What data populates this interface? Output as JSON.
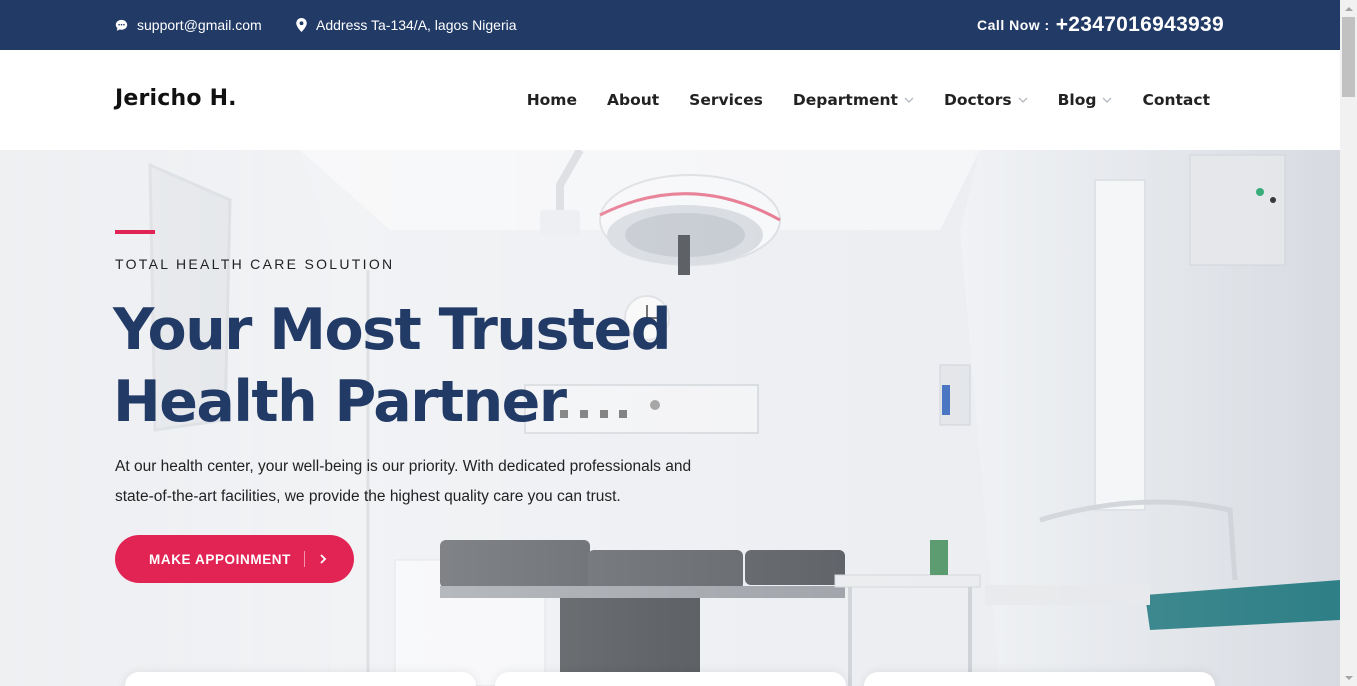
{
  "topbar": {
    "email": "support@gmail.com",
    "email_icon": "chat-bubble-icon",
    "address": "Address Ta-134/A, lagos Nigeria",
    "address_icon": "map-pin-icon",
    "call_label": "Call Now :",
    "phone": "+2347016943939"
  },
  "nav": {
    "brand": "Jericho H.",
    "items": [
      {
        "label": "Home",
        "dropdown": false
      },
      {
        "label": "About",
        "dropdown": false
      },
      {
        "label": "Services",
        "dropdown": false
      },
      {
        "label": "Department",
        "dropdown": true
      },
      {
        "label": "Doctors",
        "dropdown": true
      },
      {
        "label": "Blog",
        "dropdown": true
      },
      {
        "label": "Contact",
        "dropdown": false
      }
    ]
  },
  "hero": {
    "tagline": "TOTAL HEALTH CARE SOLUTION",
    "headline_line1": "Your Most Trusted",
    "headline_line2": "Health Partner",
    "description": "At our health center, your well-being is our priority. With dedicated professionals and state-of-the-art facilities, we provide the highest quality care you can trust.",
    "cta_label": "MAKE APPOINMENT",
    "cta_icon": "chevron-right-icon"
  },
  "colors": {
    "primary": "#223a66",
    "accent": "#e12454",
    "text": "#222222",
    "background": "#ffffff"
  }
}
